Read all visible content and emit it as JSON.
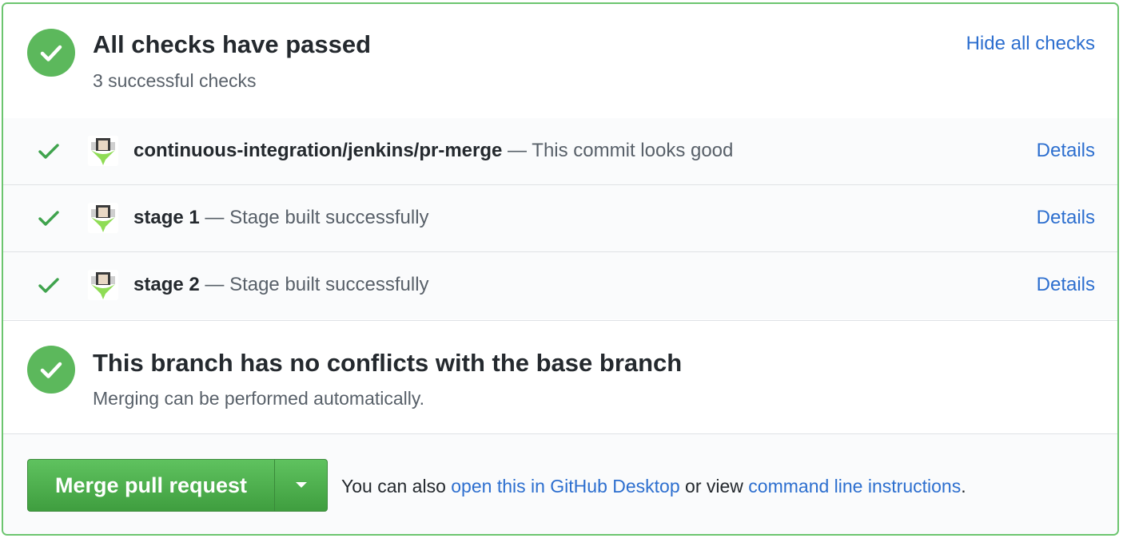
{
  "checks_header": {
    "title": "All checks have passed",
    "subtitle": "3 successful checks",
    "hide_link": "Hide all checks"
  },
  "checks": [
    {
      "name": "continuous-integration/jenkins/pr-merge",
      "separator": " — ",
      "description": "This commit looks good",
      "details": "Details"
    },
    {
      "name": "stage 1",
      "separator": " — ",
      "description": "Stage built successfully",
      "details": "Details"
    },
    {
      "name": "stage 2",
      "separator": " — ",
      "description": "Stage built successfully",
      "details": "Details"
    }
  ],
  "merge_status": {
    "title": "This branch has no conflicts with the base branch",
    "subtitle": "Merging can be performed automatically."
  },
  "merge_action": {
    "button_label": "Merge pull request",
    "text_before": "You can also ",
    "desktop_link": "open this in GitHub Desktop",
    "text_middle": " or view ",
    "cli_link": "command line instructions",
    "text_after": "."
  },
  "colors": {
    "success_green": "#5cb85c",
    "link_blue": "#2d6fcf",
    "border_green": "#6cc56f"
  },
  "icons": {
    "status": "check-circle-icon",
    "row": "check-icon",
    "avatar": "jenkins-avatar-icon",
    "dropdown": "caret-down-icon"
  }
}
